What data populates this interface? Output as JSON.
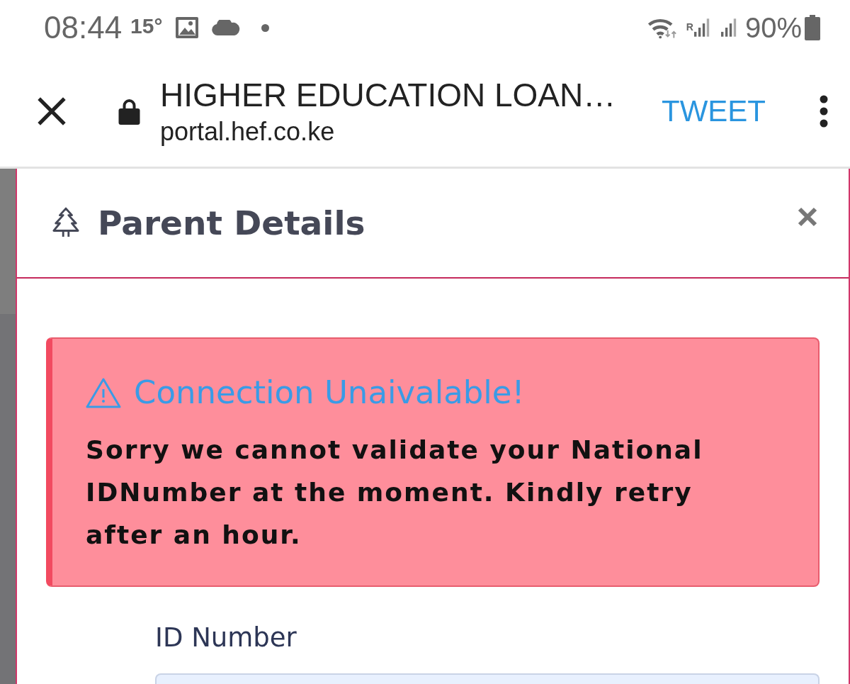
{
  "status_bar": {
    "time": "08:44",
    "temperature": "15°",
    "roaming_mark": "R",
    "battery": "90%"
  },
  "browser_bar": {
    "page_title": "HIGHER EDUCATION LOAN…",
    "url": "portal.hef.co.ke",
    "action": "TWEET"
  },
  "modal": {
    "title": "Parent Details",
    "alert": {
      "title": "Connection Unaivalable!",
      "message": "Sorry we cannot validate your National IDNumber at the moment. Kindly retry after an hour."
    },
    "fields": [
      {
        "label": "ID Number"
      }
    ]
  }
}
